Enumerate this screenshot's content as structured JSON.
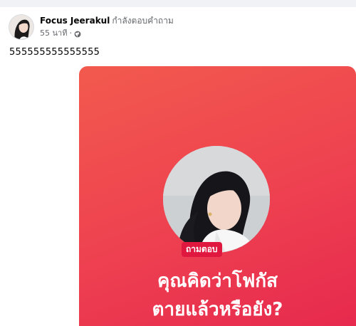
{
  "post": {
    "author": "Focus Jeerakul",
    "action": "กำลังตอบคำถาม",
    "time": "55 นาที",
    "separator": "·",
    "privacy_icon": "globe-icon",
    "text": "555555555555555"
  },
  "qa_card": {
    "badge": "ถามตอบ",
    "question_line1": "คุณคิดว่าโฟกัส",
    "question_line2": "ตายแล้วหรือยัง?",
    "colors": {
      "gradient_start": "#f25a4e",
      "gradient_end": "#e6284e",
      "badge_bg": "#e0173f"
    }
  }
}
